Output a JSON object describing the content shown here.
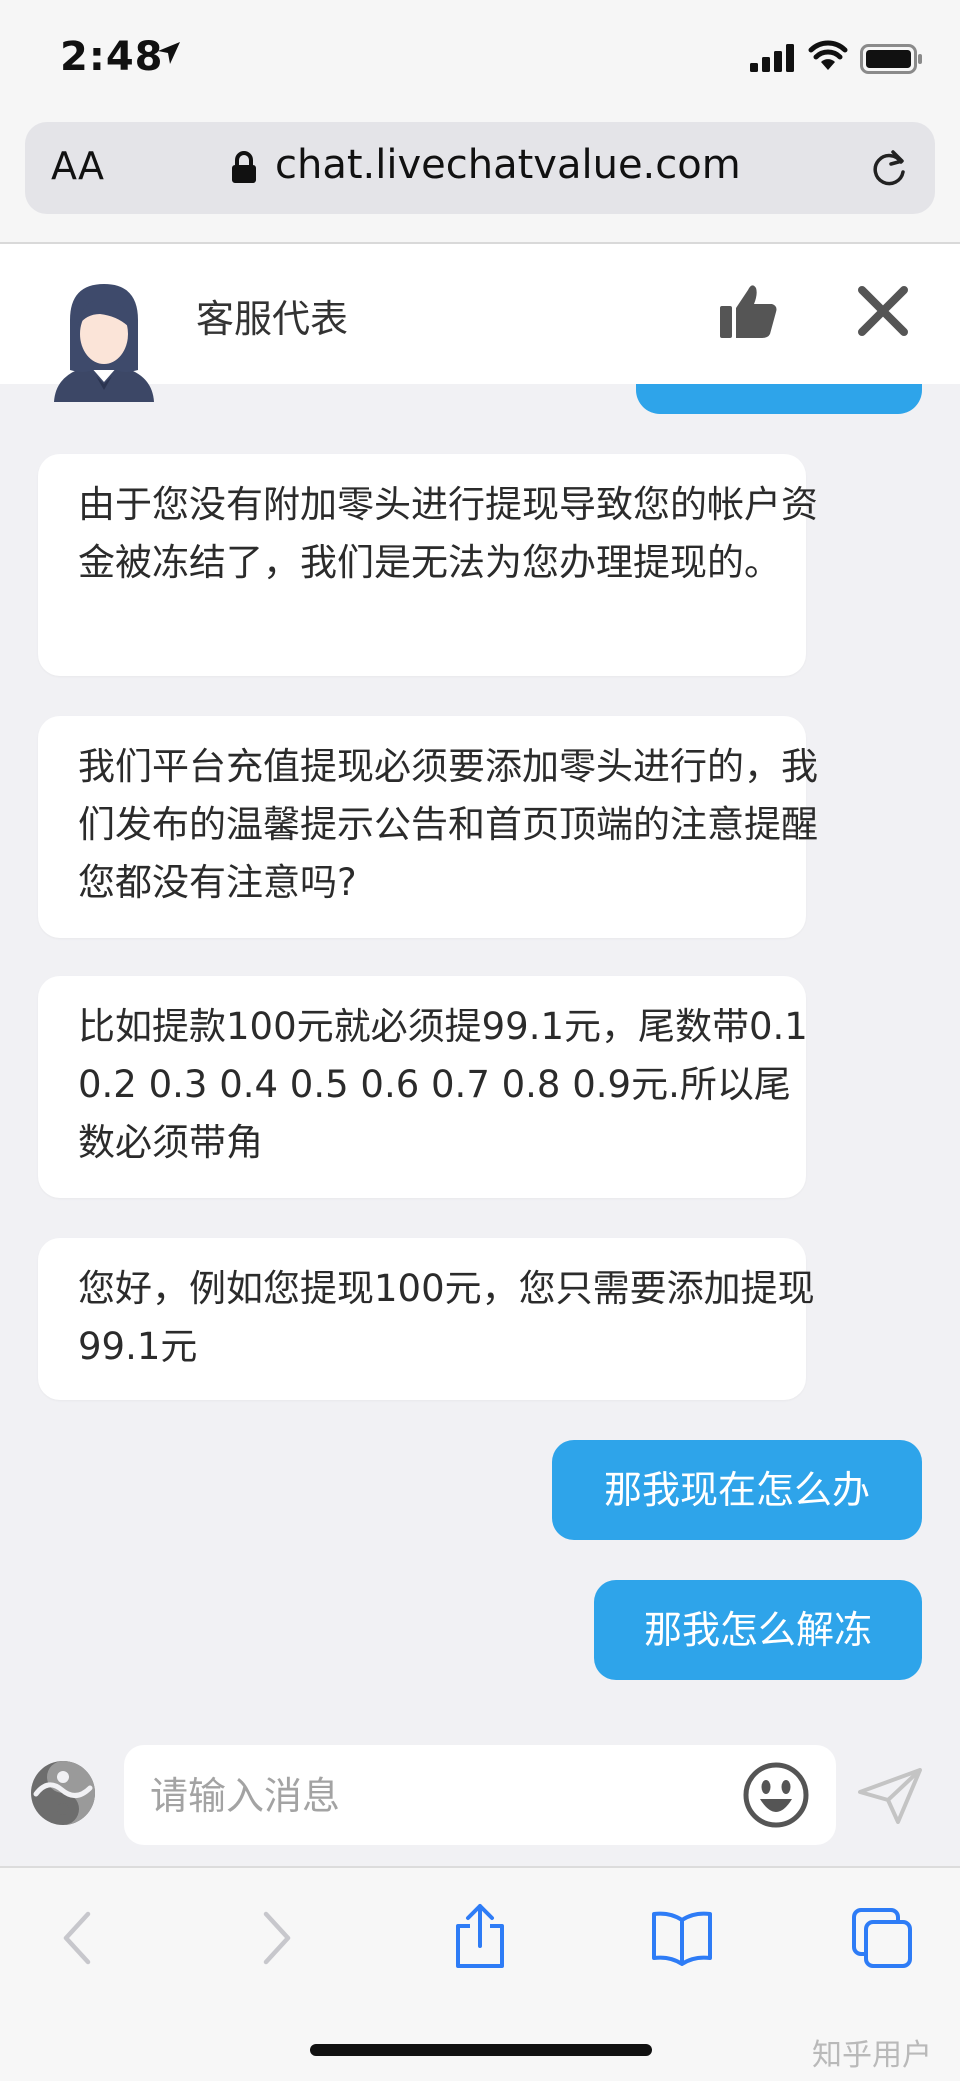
{
  "status_bar": {
    "time": "2:48"
  },
  "browser": {
    "text_size_label": "AA",
    "url": "chat.livechatvalue.com"
  },
  "chat_header": {
    "agent_name": "客服代表"
  },
  "messages": [
    {
      "from": "agent",
      "text": "由于您没有附加零头进行提现导致您的帐户资金被冻结了，我们是无法为您办理提现的。"
    },
    {
      "from": "agent",
      "text": "我们平台充值提现必须要添加零头进行的，我们发布的温馨提示公告和首页顶端的注意提醒您都没有注意吗?"
    },
    {
      "from": "agent",
      "text": "比如提款100元就必须提99.1元，尾数带0.1 0.2 0.3 0.4 0.5 0.6 0.7 0.8 0.9元.所以尾数必须带角"
    },
    {
      "from": "agent",
      "text": "您好，例如您提现100元，您只需要添加提现99.1元"
    },
    {
      "from": "user",
      "text": "那我现在怎么办"
    },
    {
      "from": "user",
      "text": "那我怎么解冻"
    }
  ],
  "composer": {
    "placeholder": "请输入消息",
    "value": ""
  },
  "watermark": "知乎用户",
  "colors": {
    "accent": "#2ea4ea",
    "background": "#f1f1f4",
    "toolbar_icon": "#2e7cf6"
  }
}
